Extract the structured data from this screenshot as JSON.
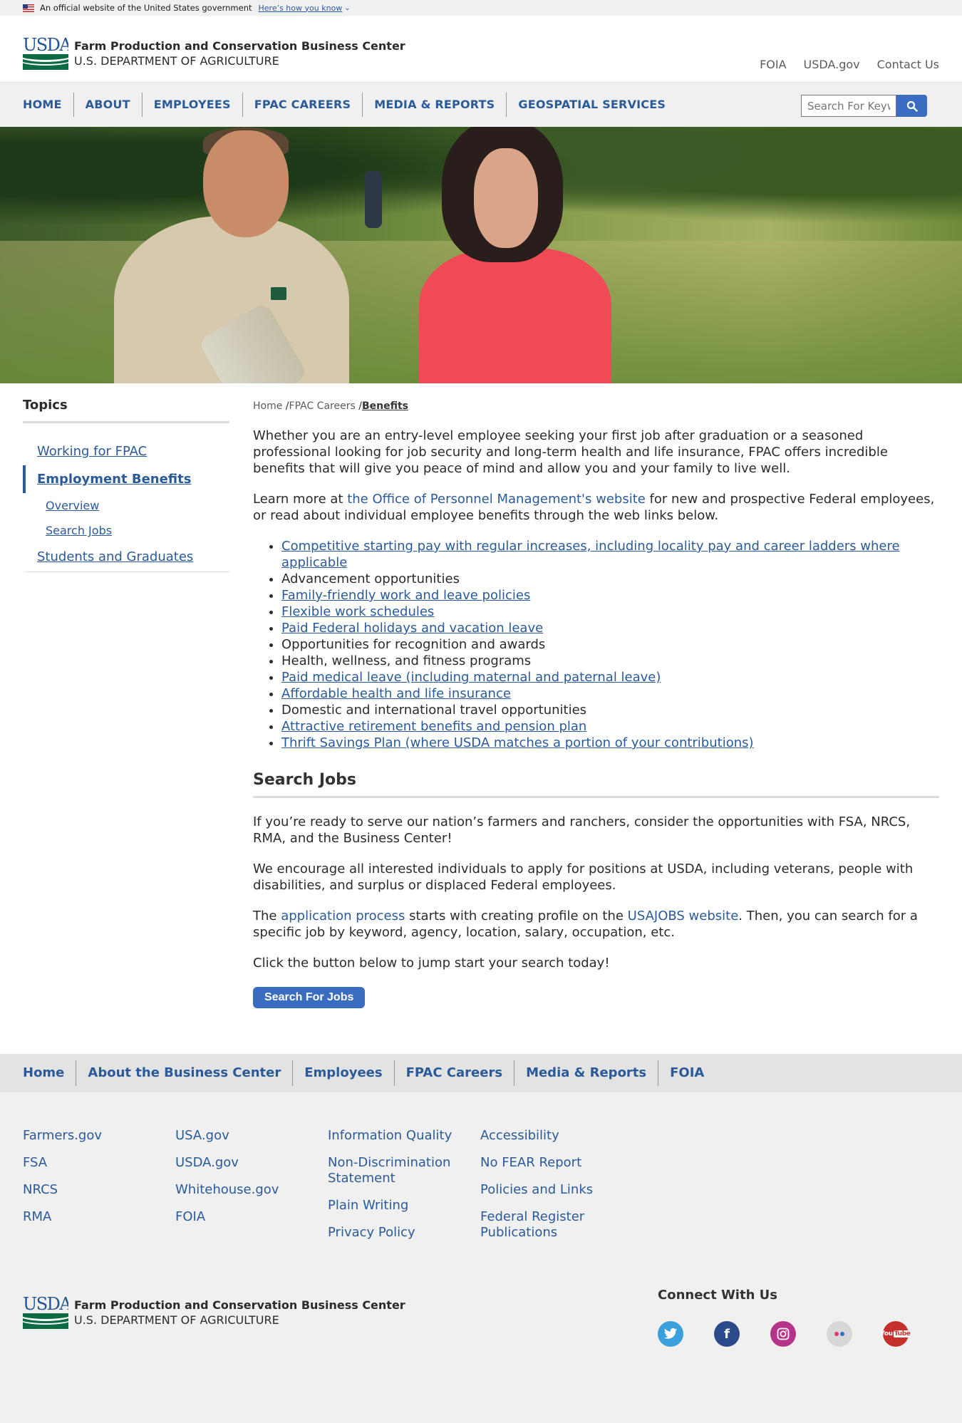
{
  "gov_banner": {
    "text": "An official website of the United States government",
    "link": "Here’s how you know"
  },
  "header": {
    "logo_text": "USDA",
    "title": "Farm Production and Conservation Business Center",
    "subtitle": "U.S. DEPARTMENT OF AGRICULTURE",
    "top_links": [
      "FOIA",
      "USDA.gov",
      "Contact Us"
    ]
  },
  "nav": {
    "items": [
      "HOME",
      "ABOUT",
      "EMPLOYEES",
      "FPAC CAREERS",
      "MEDIA & REPORTS",
      "GEOSPATIAL SERVICES"
    ],
    "search_placeholder": "Search For Keywords"
  },
  "sidebar": {
    "heading": "Topics",
    "items": [
      {
        "label": "Working for FPAC"
      },
      {
        "label": "Employment Benefits"
      },
      {
        "label": "Overview"
      },
      {
        "label": "Search Jobs"
      },
      {
        "label": "Students and Graduates"
      }
    ]
  },
  "breadcrumb": {
    "home": "Home",
    "sep": "/",
    "careers": "FPAC Careers",
    "current": "Benefits"
  },
  "content": {
    "intro": "Whether you are an entry-level employee seeking your first job after graduation or a seasoned professional looking for job security and long-term health and life insurance, FPAC offers incredible benefits that will give you peace of mind and allow you and your family to live well.",
    "learn_prefix": "Learn more at ",
    "learn_link": "the Office of Personnel Management's website",
    "learn_suffix": " for new and prospective Federal employees, or read about individual employee benefits through the web links below.",
    "benefits": [
      {
        "text": "Competitive starting pay with regular increases, including locality pay and career ladders where applicable"
      },
      {
        "text": "Advancement opportunities"
      },
      {
        "text": "Family-friendly work and leave policies"
      },
      {
        "text": "Flexible work schedules"
      },
      {
        "text": "Paid Federal holidays and vacation leave"
      },
      {
        "text": "Opportunities for recognition and awards"
      },
      {
        "text": "Health, wellness, and fitness programs"
      },
      {
        "text": "Paid medical leave (including maternal and paternal leave)"
      },
      {
        "text": "Affordable health and life insurance"
      },
      {
        "text": "Domestic and international travel opportunities"
      },
      {
        "text": "Attractive retirement benefits and pension plan"
      },
      {
        "text": "Thrift Savings Plan (where USDA matches a portion of your contributions)"
      }
    ],
    "search_heading": "Search Jobs",
    "search_p1": "If you’re ready to serve our nation’s farmers and ranchers, consider the opportunities with FSA, NRCS, RMA, and the Business Center!",
    "search_p2": "We encourage all interested individuals to apply for positions at USDA, including veterans, people with disabilities, and surplus or displaced Federal employees.",
    "search_p3_a": "The ",
    "search_p3_link1": "application process",
    "search_p3_b": " starts with creating profile on the ",
    "search_p3_link2": "USAJOBS website",
    "search_p3_c": ". Then, you can search for a specific job by keyword, agency, location, salary, occupation, etc.",
    "search_p4": "Click the button below to jump start your search today!",
    "button": "Search For Jobs"
  },
  "footer": {
    "nav": [
      "Home",
      "About the Business Center",
      "Employees",
      "FPAC Careers",
      "Media & Reports",
      "FOIA"
    ],
    "col1": [
      "Farmers.gov",
      "FSA",
      "NRCS",
      "RMA"
    ],
    "col2": [
      "USA.gov",
      "USDA.gov",
      "Whitehouse.gov",
      "FOIA"
    ],
    "col3": [
      "Information Quality",
      "Non-Discrimination Statement",
      "Plain Writing",
      "Privacy Policy"
    ],
    "col4": [
      "Accessibility",
      "No FEAR Report",
      "Policies and Links",
      "Federal Register Publications"
    ],
    "connect_heading": "Connect With Us",
    "social": [
      {
        "name": "twitter-icon",
        "color": "#3ba0dc"
      },
      {
        "name": "facebook-icon",
        "color": "#2b4a8a"
      },
      {
        "name": "instagram-icon",
        "color": "#b5338a"
      },
      {
        "name": "flickr-icon",
        "color": "#d8d8d8"
      },
      {
        "name": "youtube-icon",
        "color": "#c4302b"
      }
    ]
  },
  "colors": {
    "link": "#2a5a99",
    "button": "#3a6dbf",
    "usda_green": "#0c6b42"
  }
}
